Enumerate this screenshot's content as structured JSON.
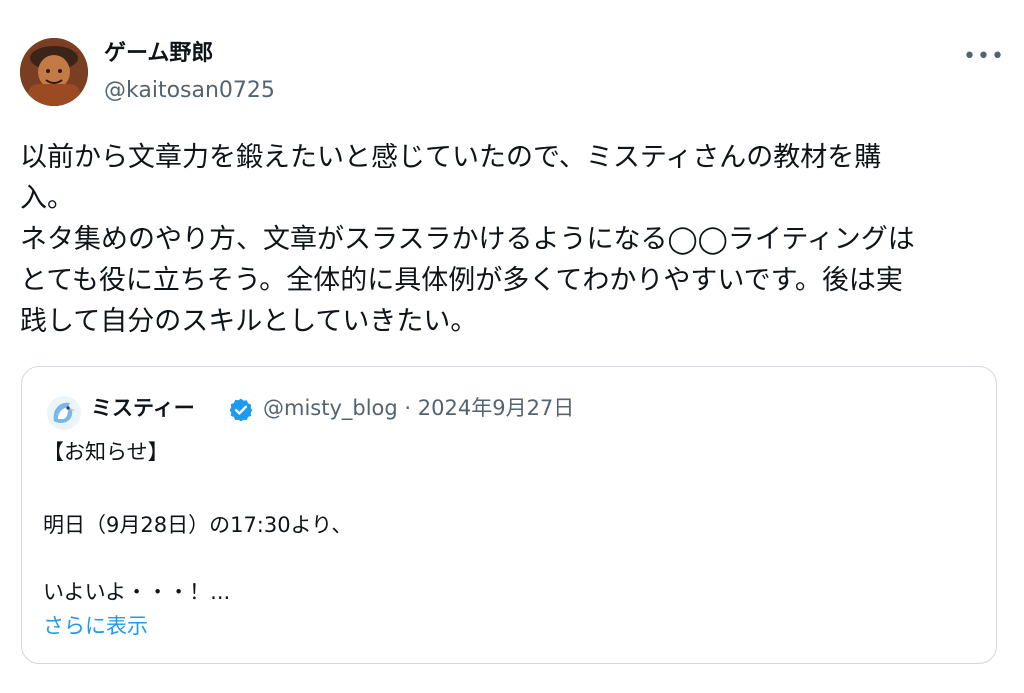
{
  "tweet": {
    "author": {
      "display_name": "ゲーム野郎",
      "handle": "@kaitosan0725",
      "avatar_icon": "user-avatar-icon"
    },
    "more_icon": "more-horizontal-icon",
    "more_label": "•••",
    "body_lines": [
      "以前から文章力を鍛えたいと感じていたので、ミスティさんの教材を購",
      "入。",
      "ネタ集めのやり方、文章がスラスラかけるようになる◯◯ライティングは",
      "とても役に立ちそう。全体的に具体例が多くてわかりやすいです。後は実",
      "践して自分のスキルとしていきたい。"
    ],
    "quote": {
      "display_name": "ミスティー",
      "verified_icon": "verified-badge-icon",
      "meta": "@misty_blog · 2024年9月27日",
      "lines": [
        "【お知らせ】",
        "明日（9月28日）の17:30より、",
        "いよいよ・・・！..."
      ],
      "show_more": "さらに表示"
    }
  },
  "colors": {
    "text_primary": "#0f1419",
    "text_secondary": "#536471",
    "link": "#1d9bf0",
    "border": "#cfd9de"
  }
}
